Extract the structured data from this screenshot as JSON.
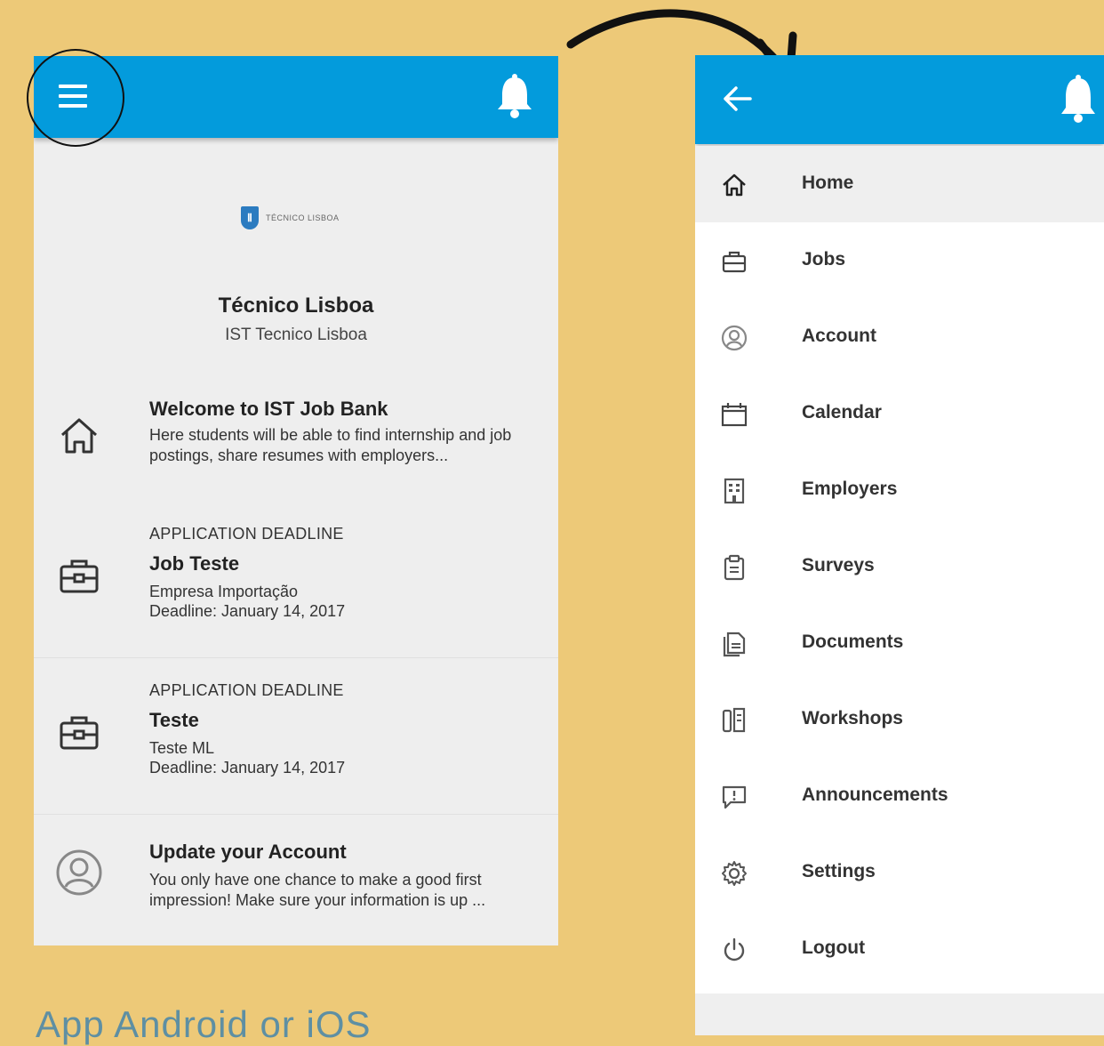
{
  "left_screen": {
    "org": {
      "logo_text": "TÉCNICO LISBOA",
      "title": "Técnico Lisboa",
      "subtitle": "IST Tecnico Lisboa"
    },
    "feed": [
      {
        "icon": "home-icon",
        "title": "Welcome to IST Job Bank",
        "body": "Here students will be able to find internship and job postings, share resumes with employers..."
      },
      {
        "icon": "briefcase-icon",
        "label": "APPLICATION DEADLINE",
        "title": "Job Teste",
        "line1": "Empresa Importação",
        "line2": "Deadline: January 14, 2017"
      },
      {
        "icon": "briefcase-icon",
        "label": "APPLICATION DEADLINE",
        "title": "Teste",
        "line1": "Teste ML",
        "line2": "Deadline: January 14, 2017"
      },
      {
        "icon": "account-icon",
        "title": "Update your Account",
        "body": "You only have one chance to make a good first impression! Make sure your information is up ..."
      }
    ]
  },
  "caption": "App Android or iOS",
  "right_screen": {
    "menu": [
      {
        "label": "Home",
        "icon": "home-icon",
        "active": true
      },
      {
        "label": "Jobs",
        "icon": "briefcase-icon"
      },
      {
        "label": "Account",
        "icon": "account-icon"
      },
      {
        "label": "Calendar",
        "icon": "calendar-icon"
      },
      {
        "label": "Employers",
        "icon": "building-icon"
      },
      {
        "label": "Surveys",
        "icon": "clipboard-icon"
      },
      {
        "label": "Documents",
        "icon": "documents-icon"
      },
      {
        "label": "Workshops",
        "icon": "workshops-icon"
      },
      {
        "label": "Announcements",
        "icon": "announcement-icon"
      },
      {
        "label": "Settings",
        "icon": "gear-icon"
      },
      {
        "label": "Logout",
        "icon": "power-icon"
      }
    ]
  },
  "colors": {
    "background": "#EDC978",
    "appbar": "#039BDC",
    "caption": "#5E8FA3"
  }
}
